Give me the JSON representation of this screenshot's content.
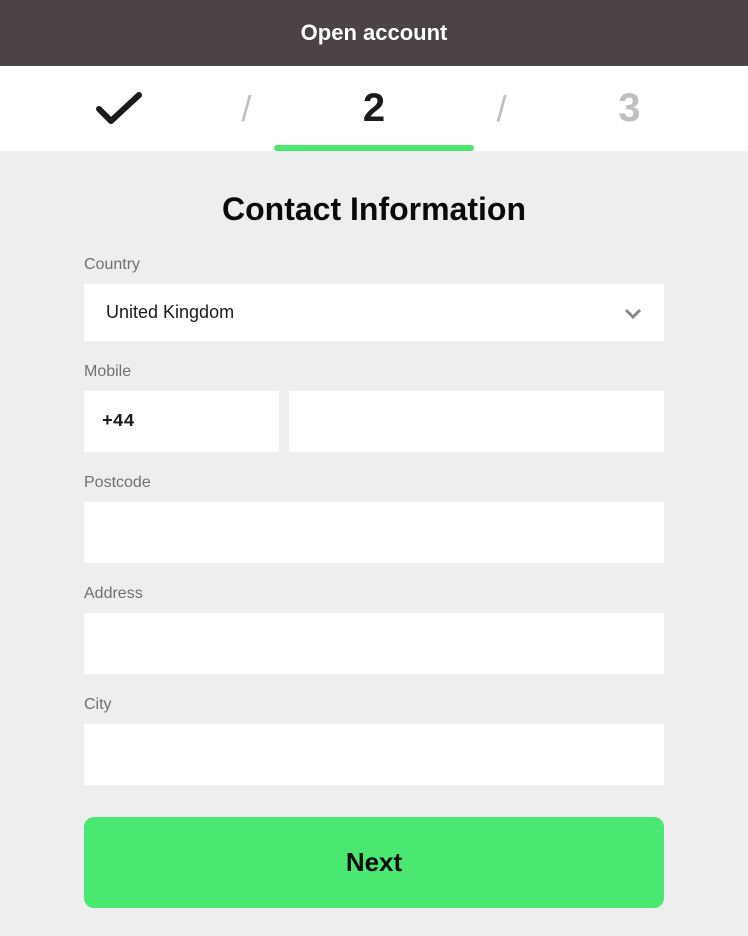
{
  "header": {
    "title": "Open account"
  },
  "stepper": {
    "step2": "2",
    "step3": "3"
  },
  "form": {
    "title": "Contact Information",
    "country": {
      "label": "Country",
      "value": "United Kingdom"
    },
    "mobile": {
      "label": "Mobile",
      "prefix": "+44",
      "value": ""
    },
    "postcode": {
      "label": "Postcode",
      "value": ""
    },
    "address": {
      "label": "Address",
      "value": ""
    },
    "city": {
      "label": "City",
      "value": ""
    },
    "next_label": "Next"
  }
}
